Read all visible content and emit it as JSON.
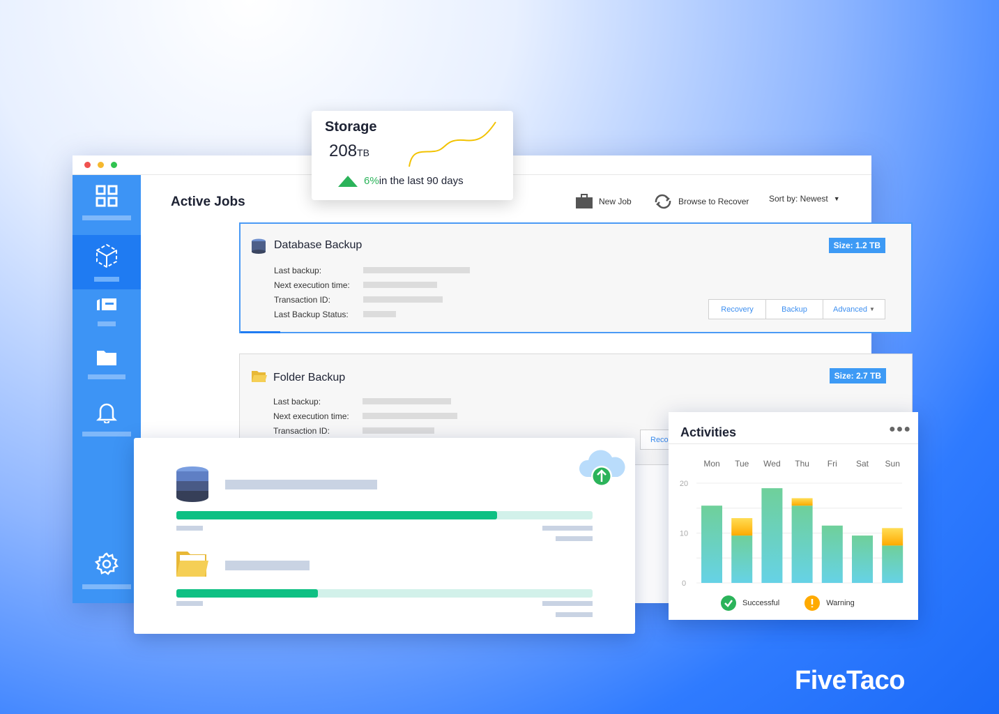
{
  "window": {
    "dots": [
      "#f0524f",
      "#f5b82e",
      "#30c350"
    ]
  },
  "sidebar": {
    "items": [
      {
        "icon": "grid-icon"
      },
      {
        "icon": "cube-icon",
        "active": true
      },
      {
        "icon": "cards-icon"
      },
      {
        "icon": "folder-icon"
      },
      {
        "icon": "bell-icon"
      },
      {
        "icon": "gear-icon"
      }
    ]
  },
  "header": {
    "title": "Active Jobs",
    "new_job": "New Job",
    "browse": "Browse to Recover",
    "sort": "Sort by: Newest"
  },
  "jobs": [
    {
      "title": "Database Backup",
      "size": "Size:  1.2 TB",
      "fields": [
        "Last backup:",
        "Next execution time:",
        "Transaction ID:",
        "Last Backup Status:"
      ],
      "buttons": [
        "Recovery",
        "Backup",
        "Advanced"
      ]
    },
    {
      "title": "Folder Backup",
      "size": "Size:  2.7 TB",
      "fields": [
        "Last backup:",
        "Next execution time:",
        "Transaction ID:"
      ],
      "buttons": [
        "Reco"
      ]
    }
  ],
  "storage": {
    "title": "Storage",
    "value": "208",
    "unit": "TB",
    "change": "6%",
    "change_text": " in the last 90 days",
    "accent": "#2bb35a",
    "line_color": "#f2c200"
  },
  "uploads": {
    "progress": [
      0.77,
      0.34
    ]
  },
  "activities": {
    "title": "Activities",
    "legend": [
      "Successful",
      "Warning"
    ]
  },
  "chart_data": {
    "type": "bar",
    "stacked": true,
    "categories": [
      "Mon",
      "Tue",
      "Wed",
      "Thu",
      "Fri",
      "Sat",
      "Sun"
    ],
    "series": [
      {
        "name": "Successful",
        "values": [
          15.5,
          9.5,
          19,
          15.5,
          11.5,
          9.5,
          7.5
        ]
      },
      {
        "name": "Warning",
        "values": [
          0,
          3.5,
          0,
          1.5,
          0,
          0,
          3.5
        ]
      }
    ],
    "yticks": [
      "0",
      "10",
      "20"
    ],
    "ylim": [
      0,
      20
    ],
    "grid": true,
    "legend": "bottom"
  },
  "brand": "FiveTaco"
}
